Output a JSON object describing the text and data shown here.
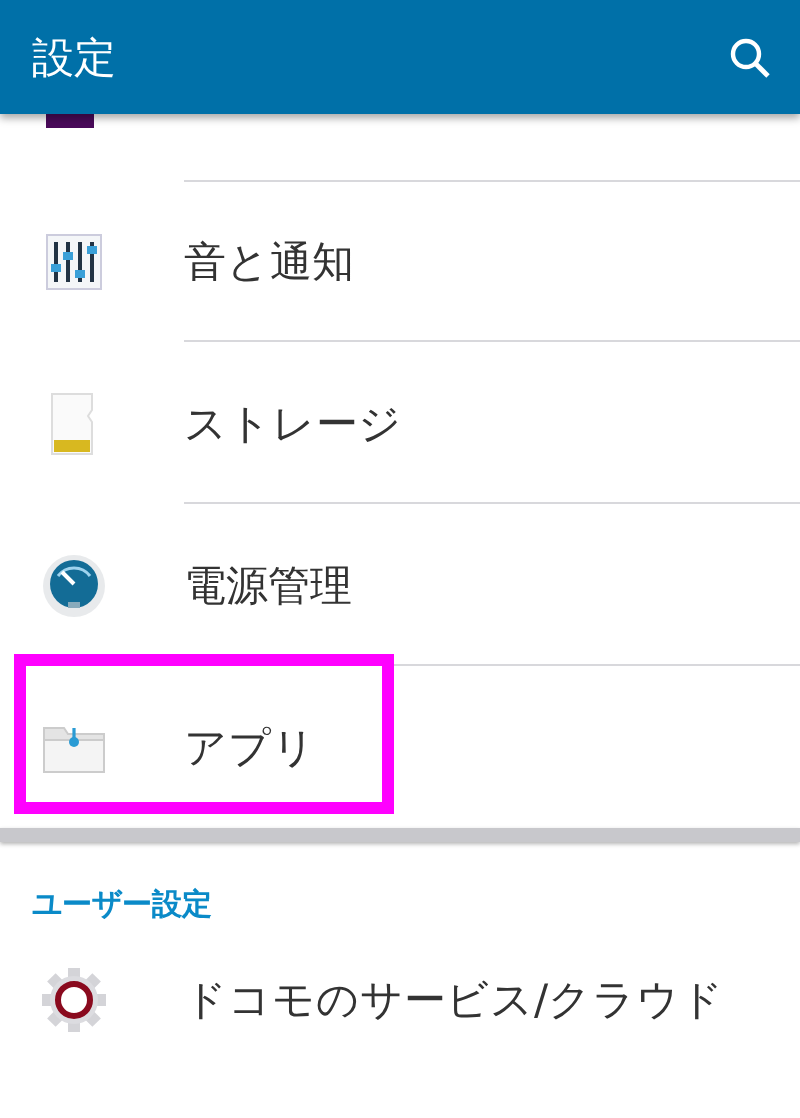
{
  "app_bar": {
    "title": "設定"
  },
  "items": [
    {
      "kind": "sound",
      "label": "音と通知",
      "highlighted": false
    },
    {
      "kind": "storage",
      "label": "ストレージ",
      "highlighted": false
    },
    {
      "kind": "power",
      "label": "電源管理",
      "highlighted": false
    },
    {
      "kind": "apps",
      "label": "アプリ",
      "highlighted": true
    }
  ],
  "user_section": {
    "heading": "ユーザー設定",
    "items": [
      {
        "kind": "gear",
        "label": "ドコモのサービス/クラウド",
        "highlighted": false
      }
    ]
  }
}
